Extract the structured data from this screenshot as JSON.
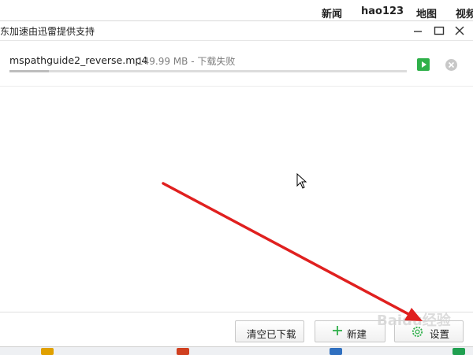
{
  "top_nav": {
    "links": [
      "新闻",
      "hao123",
      "地图",
      "视频"
    ]
  },
  "window": {
    "title": "东加速由迅雷提供支持"
  },
  "download": {
    "filename": "mspathguide2_reverse.mp4",
    "status": "149.99 MB - 下载失败",
    "progress": 0.1
  },
  "buttons": {
    "clear_label": "清空已下载",
    "new_label": "新建",
    "settings_label": "设置"
  },
  "watermark": "Baidu经验",
  "colors": {
    "accent_green": "#2fb04a",
    "annotation_arrow": "#e0201f"
  },
  "icons": {
    "play": "play-icon",
    "delete": "close-circle-icon",
    "new": "plus-icon",
    "settings": "gear-icon"
  }
}
